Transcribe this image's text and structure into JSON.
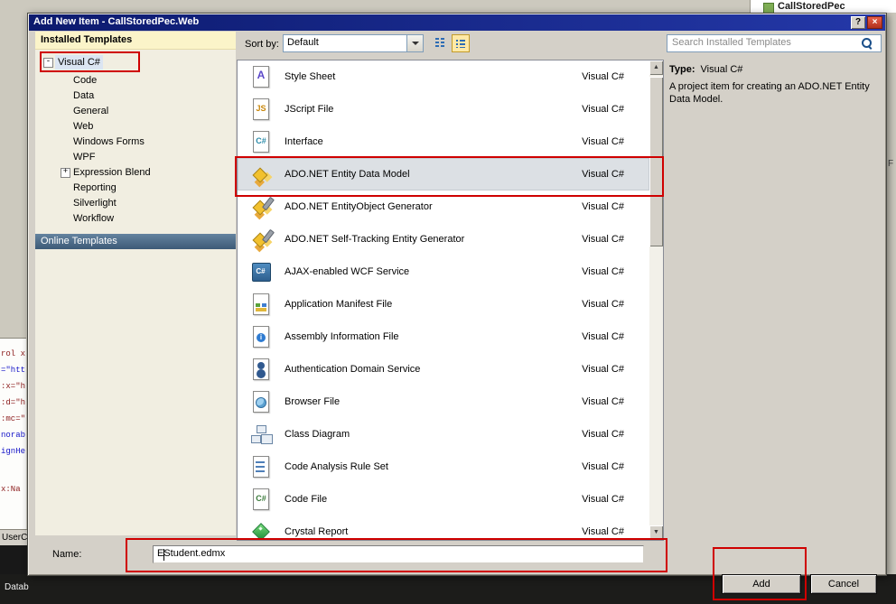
{
  "colors": {
    "annotation_red": "#cf0000",
    "titlebar_blue": "#0c1a6e",
    "dialog_face": "#d4d0c8",
    "sidebar_face": "#f1eee1",
    "installed_header_bg": "#fbf4c9",
    "online_header_bg": "#3d5a77",
    "selection_bg": "#dce0e4",
    "close_button_red": "#b1301c"
  },
  "window": {
    "title": "Add New Item - CallStoredPec.Web",
    "help_glyph": "?",
    "close_glyph": "×"
  },
  "sidebar": {
    "installed_header": "Installed Templates",
    "online_header": "Online Templates",
    "root": {
      "label": "Visual C#",
      "expander": "-"
    },
    "items": [
      {
        "label": "Code"
      },
      {
        "label": "Data"
      },
      {
        "label": "General"
      },
      {
        "label": "Web"
      },
      {
        "label": "Windows Forms"
      },
      {
        "label": "WPF"
      },
      {
        "label": "Expression Blend",
        "expander": "+"
      },
      {
        "label": "Reporting"
      },
      {
        "label": "Silverlight"
      },
      {
        "label": "Workflow"
      }
    ]
  },
  "toolbar": {
    "sort_label": "Sort by:",
    "sort_value": "Default",
    "search_text": "Search Installed Templates"
  },
  "list": {
    "items": [
      {
        "name": "Style Sheet",
        "type": "Visual C#"
      },
      {
        "name": "JScript File",
        "type": "Visual C#"
      },
      {
        "name": "Interface",
        "type": "Visual C#"
      },
      {
        "name": "ADO.NET Entity Data Model",
        "type": "Visual C#"
      },
      {
        "name": "ADO.NET EntityObject Generator",
        "type": "Visual C#"
      },
      {
        "name": "ADO.NET Self-Tracking Entity Generator",
        "type": "Visual C#"
      },
      {
        "name": "AJAX-enabled WCF Service",
        "type": "Visual C#"
      },
      {
        "name": "Application Manifest File",
        "type": "Visual C#"
      },
      {
        "name": "Assembly Information File",
        "type": "Visual C#"
      },
      {
        "name": "Authentication Domain Service",
        "type": "Visual C#"
      },
      {
        "name": "Browser File",
        "type": "Visual C#"
      },
      {
        "name": "Class Diagram",
        "type": "Visual C#"
      },
      {
        "name": "Code Analysis Rule Set",
        "type": "Visual C#"
      },
      {
        "name": "Code File",
        "type": "Visual C#"
      },
      {
        "name": "Crystal Report",
        "type": "Visual C#"
      }
    ]
  },
  "info": {
    "type_label": "Type:",
    "type_value": "Visual C#",
    "description": "A project item for creating an ADO.NET Entity Data Model."
  },
  "footer": {
    "name_label": "Name:",
    "name_value": "EStudent.edmx",
    "add_label": "Add",
    "cancel_label": "Cancel"
  },
  "background": {
    "solution_item": "CallStoredPec",
    "code_lines": [
      "rol x",
      "=\"htt",
      ":x=\"h",
      ":d=\"h",
      ":mc=\"",
      "norab",
      "ignHe",
      "x:Na"
    ],
    "user_control_label": "UserCor",
    "taskbar_label": "Datab",
    "right_edge_fragment": "F"
  }
}
